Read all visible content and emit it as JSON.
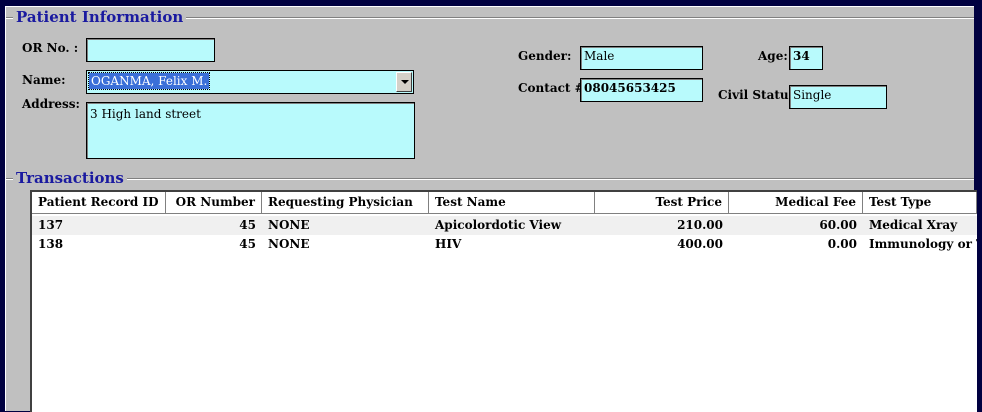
{
  "patient_info": {
    "group_title": "Patient Information",
    "or_no": {
      "label": "OR No. :",
      "value": ""
    },
    "name": {
      "label": "Name:",
      "value": "OGANMA, Felix M."
    },
    "address": {
      "label": "Address:",
      "value": "3 High land street"
    },
    "gender": {
      "label": "Gender:",
      "value": "Male"
    },
    "contact": {
      "label": "Contact #:",
      "value": "08045653425"
    },
    "age": {
      "label": "Age:",
      "value": "34"
    },
    "civil_status": {
      "label": "Civil Status:",
      "value": "Single"
    }
  },
  "transactions": {
    "group_title": "Transactions",
    "columns": [
      "Patient Record ID",
      "OR Number",
      "Requesting Physician",
      "Test Name",
      "Test Price",
      "Medical Fee",
      "Test Type"
    ],
    "rows": [
      [
        "137",
        "45",
        "NONE",
        "Apicolordotic View",
        "210.00",
        "60.00",
        "Medical Xray"
      ],
      [
        "138",
        "45",
        "NONE",
        "HIV",
        "400.00",
        "0.00",
        "Immunology or T"
      ]
    ]
  },
  "colors": {
    "field_bg": "#b8fafc",
    "title_blue": "#1a1aa0",
    "window_bg": "#c0c0c0",
    "frame_navy": "#000040",
    "selection_blue": "#3b6fd8"
  }
}
